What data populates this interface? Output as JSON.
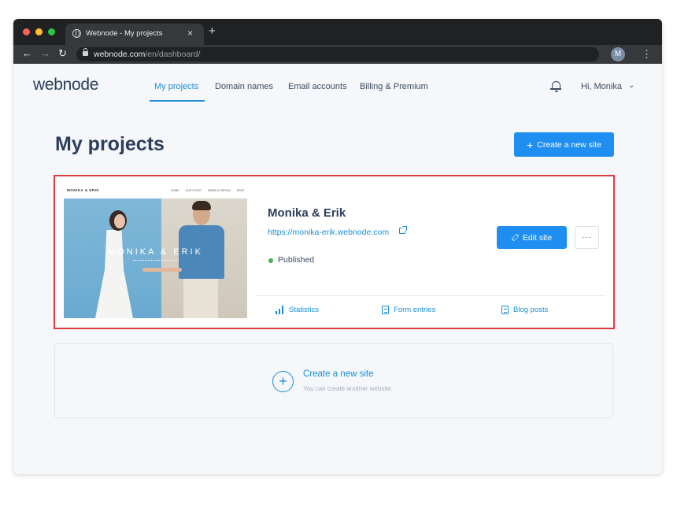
{
  "browser": {
    "tab_title": "Webnode - My projects",
    "tab_close": "×",
    "new_tab": "+",
    "url_host": "webnode.com",
    "url_path": "/en/dashboard/",
    "profile_initial": "M",
    "traffic_colors": [
      "#ff5f57",
      "#febc2e",
      "#28c840"
    ]
  },
  "header": {
    "logo": "webnode",
    "nav": [
      {
        "label": "My projects",
        "active": true
      },
      {
        "label": "Domain names",
        "active": false
      },
      {
        "label": "Email accounts",
        "active": false
      },
      {
        "label": "Billing & Premium",
        "active": false
      }
    ],
    "greeting": "Hi, Monika"
  },
  "main": {
    "title": "My projects",
    "create_button": "Create a new site"
  },
  "project": {
    "thumbnail": {
      "brand": "MONIKA & ERIK",
      "menu": [
        "HOME",
        "OUR STORY",
        "BRIDE & GROOM",
        "RSVP"
      ],
      "hero_name": "MONIKA & ERIK"
    },
    "name": "Monika & Erik",
    "url": "https://monika-erik.webnode.com",
    "status": "Published",
    "edit_button": "Edit site",
    "more_button": "···",
    "links": [
      {
        "label": "Statistics",
        "icon": "bar-chart-icon"
      },
      {
        "label": "Form entries",
        "icon": "document-icon"
      },
      {
        "label": "Blog posts",
        "icon": "document-icon"
      }
    ]
  },
  "create_box": {
    "title": "Create a new site",
    "subtitle": "You can create another website."
  },
  "colors": {
    "accent": "#1f8ef1",
    "highlight": "#e03a3e",
    "status_green": "#4caf50"
  }
}
